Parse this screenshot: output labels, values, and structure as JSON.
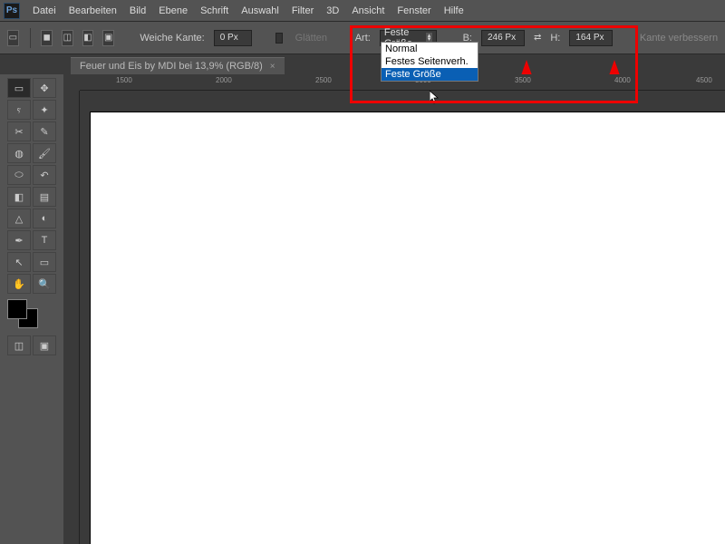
{
  "app": {
    "logo": "Ps"
  },
  "menu": [
    "Datei",
    "Bearbeiten",
    "Bild",
    "Ebene",
    "Schrift",
    "Auswahl",
    "Filter",
    "3D",
    "Ansicht",
    "Fenster",
    "Hilfe"
  ],
  "options": {
    "feather_label": "Weiche Kante:",
    "feather_value": "0 Px",
    "antialias_label": "Glätten",
    "style_label": "Art:",
    "style_value": "Feste Größe",
    "width_label": "B:",
    "width_value": "246 Px",
    "height_label": "H:",
    "height_value": "164 Px",
    "refine_label": "Kante verbessern"
  },
  "dropdown": {
    "items": [
      "Normal",
      "Festes Seitenverh.",
      "Feste Größe"
    ],
    "selected_index": 2
  },
  "tab": {
    "title": "Feuer und Eis by MDI bei 13,9% (RGB/8)",
    "close": "×"
  },
  "ruler_ticks": [
    "1500",
    "2000",
    "2500",
    "3000",
    "3500",
    "4000",
    "4500"
  ],
  "tools": {
    "marquee": "▭",
    "move": "✥",
    "lasso": "ⲋ",
    "wand": "✦",
    "crop": "✂",
    "eyedrop": "✎",
    "heal": "◍",
    "brush": "🖌",
    "stamp": "⬭",
    "history": "↶",
    "eraser": "◧",
    "grad": "▤",
    "blur": "△",
    "dodge": "◐",
    "pen": "✒",
    "type": "T",
    "path": "↖",
    "shape": "▭",
    "hand": "✋",
    "zoom": "🔍"
  },
  "bottom_tools": {
    "quickmask": "◫",
    "screen": "▣"
  }
}
